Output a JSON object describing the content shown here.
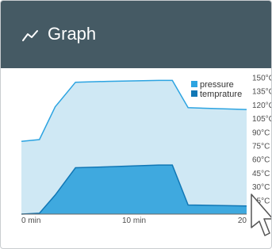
{
  "header": {
    "title": "Graph",
    "icon": "line-chart-icon"
  },
  "colors": {
    "header_bg": "#455a64",
    "pressure": "#2da4e1",
    "temprature": "#1177b5"
  },
  "legend": {
    "items": [
      "pressure",
      "temprature"
    ]
  },
  "chart_data": {
    "type": "area",
    "x_unit": "min",
    "xlim": [
      0,
      20
    ],
    "ylim": [
      0,
      150
    ],
    "x_ticks": [
      "0 min",
      "10 min",
      "20"
    ],
    "y_ticks": [
      "150°C",
      "135°C",
      "120°C",
      "105°C",
      "90°C",
      "75°C",
      "60°C",
      "45°C",
      "30°C",
      "15°C"
    ],
    "series": [
      {
        "name": "pressure",
        "x": [
          0,
          1.6,
          3.0,
          4.8,
          7.6,
          12.2,
          13.4,
          14.8,
          20
        ],
        "values": [
          80,
          82,
          118,
          145,
          146,
          147,
          147,
          117,
          115
        ]
      },
      {
        "name": "temprature",
        "x": [
          0,
          1.6,
          3.0,
          4.8,
          7.6,
          12.2,
          13.4,
          14.8,
          20
        ],
        "values": [
          0,
          1,
          21,
          51,
          52,
          54,
          54,
          10,
          9
        ]
      }
    ]
  }
}
